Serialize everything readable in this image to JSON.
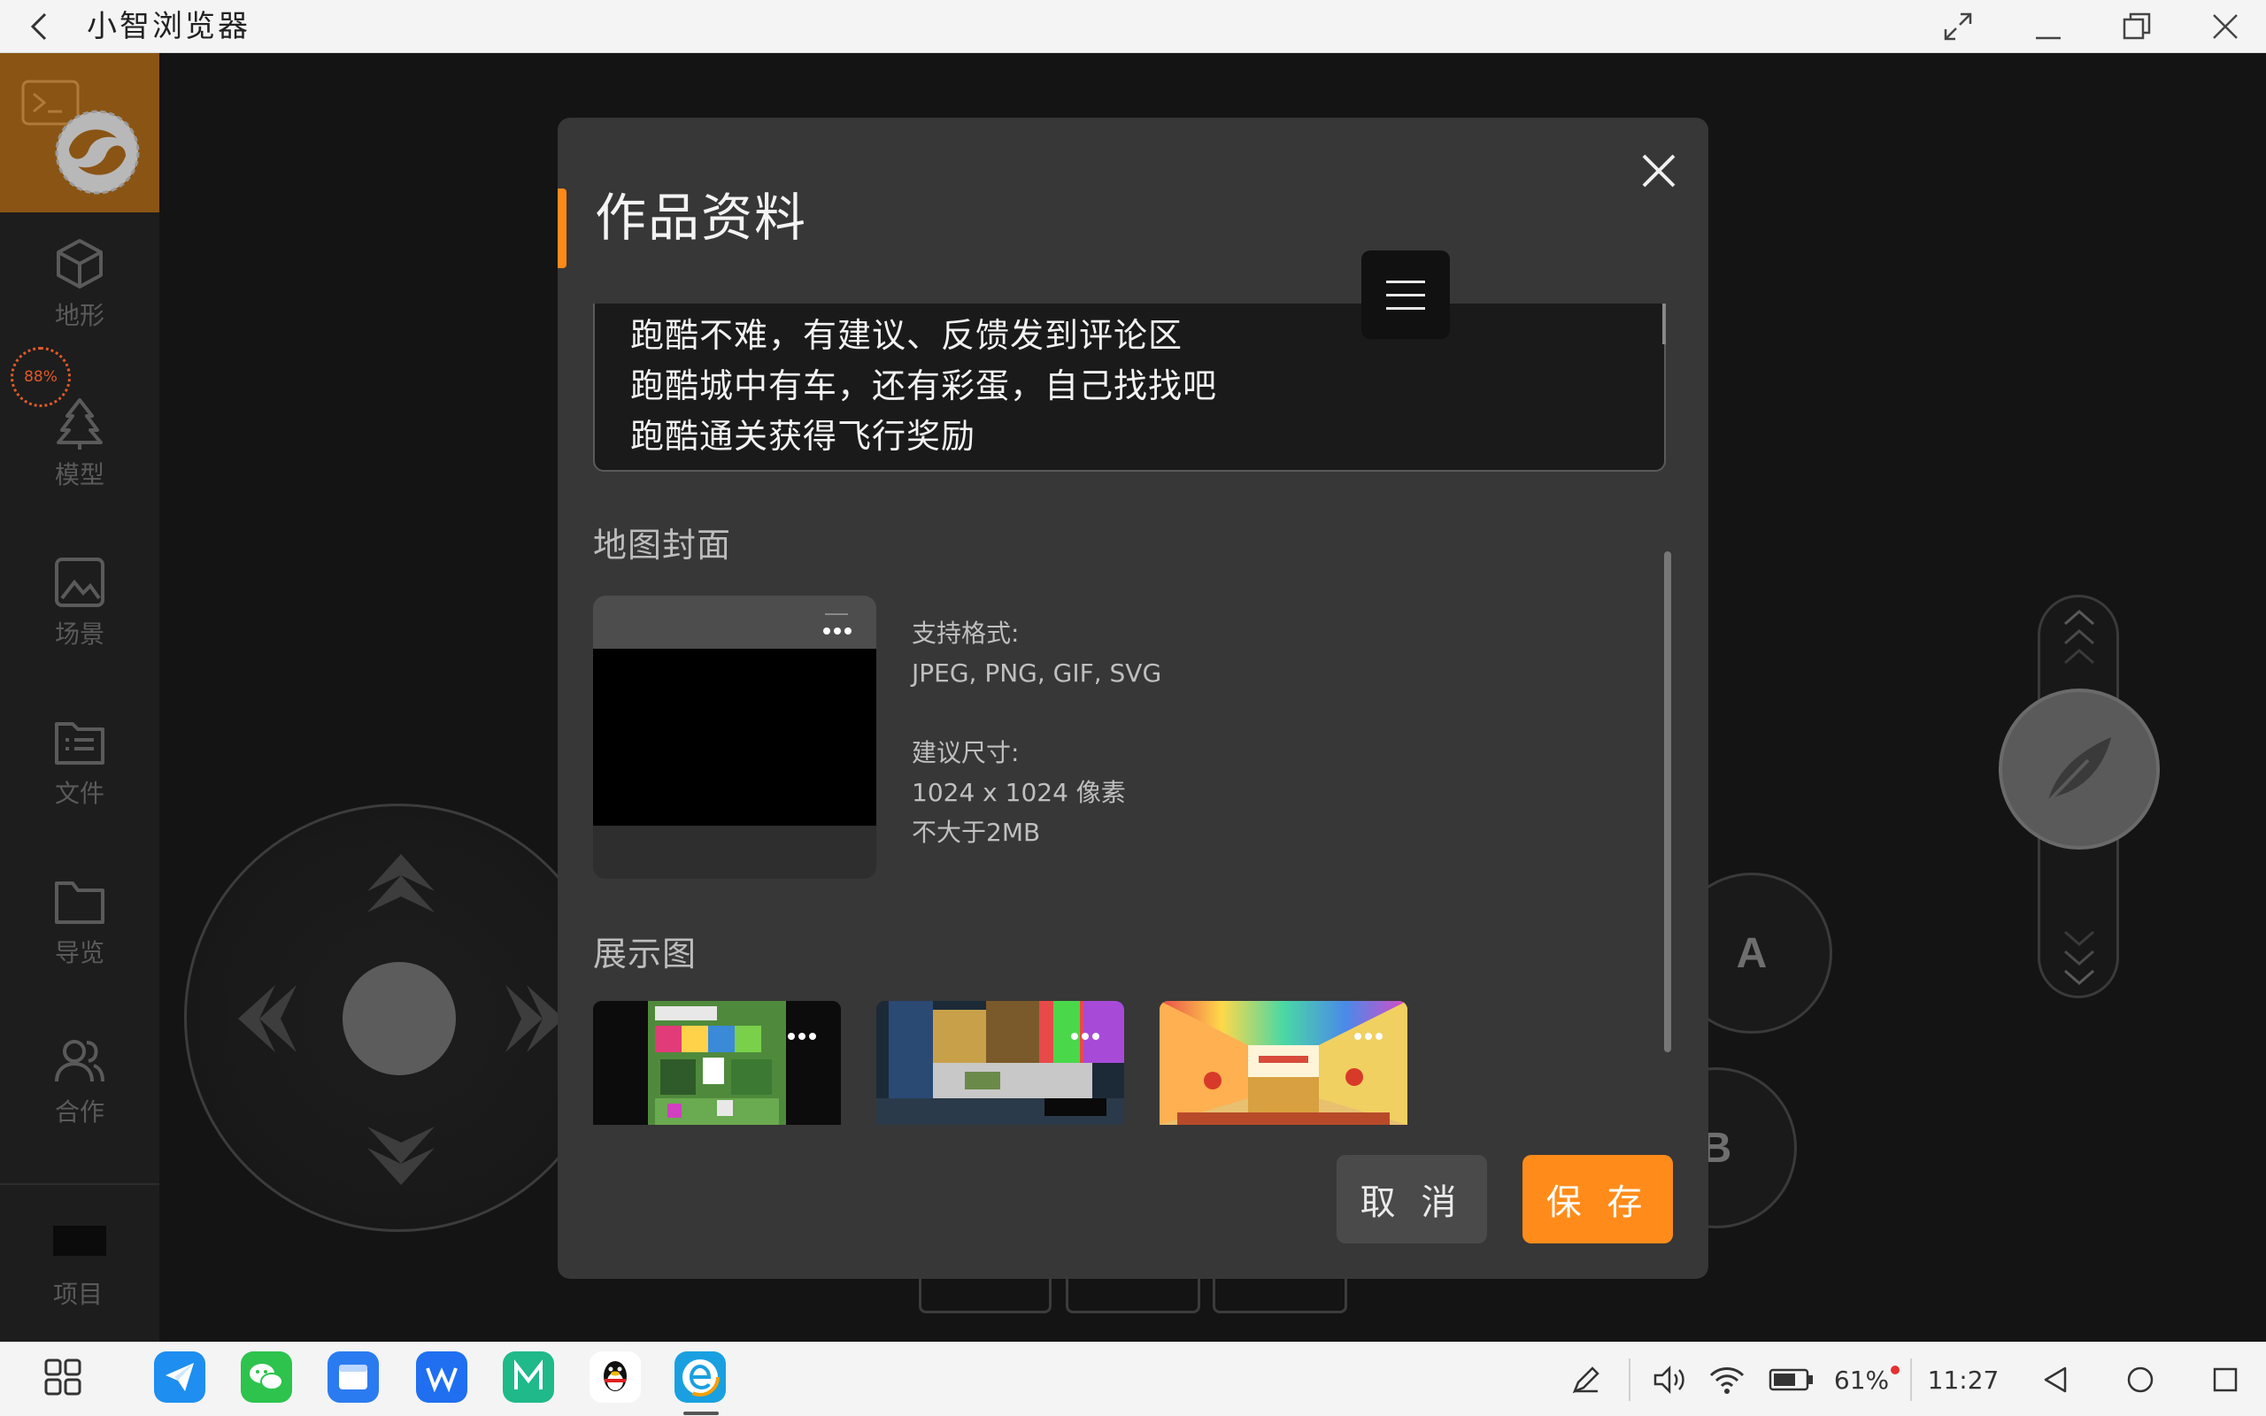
{
  "browser": {
    "title": "小智浏览器"
  },
  "sidebar": {
    "fps": "88%",
    "items": [
      {
        "label": "地形",
        "icon": "cube-icon"
      },
      {
        "label": "模型",
        "icon": "tree-icon"
      },
      {
        "label": "场景",
        "icon": "image-icon"
      },
      {
        "label": "文件",
        "icon": "file-list-icon"
      },
      {
        "label": "导览",
        "icon": "folder-icon"
      },
      {
        "label": "合作",
        "icon": "users-icon"
      }
    ],
    "project_label": "项目"
  },
  "controls": {
    "button_a": "A",
    "button_b": "B"
  },
  "dialog": {
    "title": "作品资料",
    "description_lines": [
      "跑酷不难，有建议、反馈发到评论区",
      "跑酷城中有车，还有彩蛋，自己找找吧",
      "跑酷通关获得飞行奖励"
    ],
    "cover_section": "地图封面",
    "cover_info": {
      "formats_label": "支持格式:",
      "formats": "JPEG, PNG, GIF, SVG",
      "size_label": "建议尺寸:",
      "size": "1024 x 1024 像素",
      "max": "不大于2MB"
    },
    "gallery_section": "展示图",
    "cancel_label": "取 消",
    "save_label": "保 存"
  },
  "taskbar": {
    "battery": "61%",
    "time": "11:27"
  },
  "colors": {
    "accent": "#ff8c1a",
    "dialog_bg": "#373737",
    "sidebar_logo": "#8a5514"
  }
}
